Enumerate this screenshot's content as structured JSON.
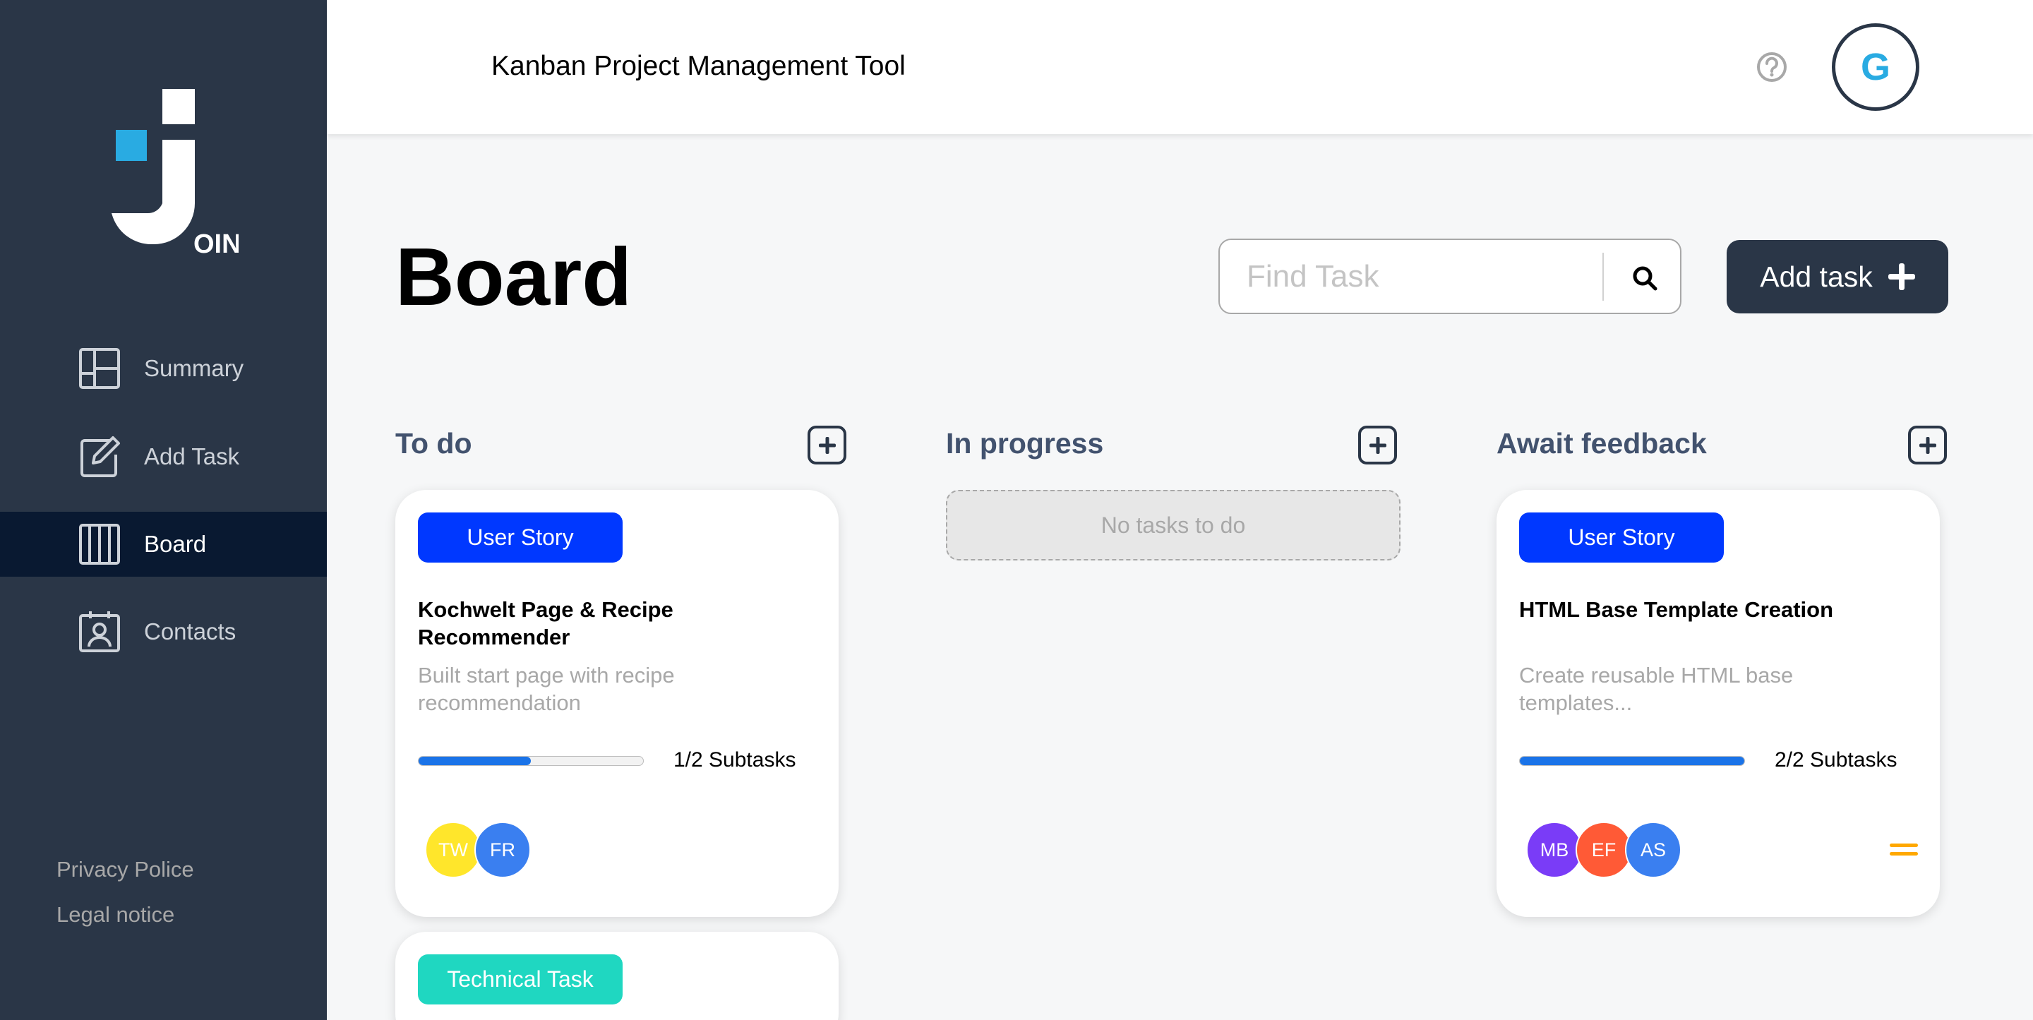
{
  "app": {
    "header_title": "Kanban Project Management Tool",
    "user_initial": "G",
    "logo_text": "OIN"
  },
  "sidebar": {
    "items": [
      {
        "label": "Summary",
        "icon": "summary-icon",
        "active": false
      },
      {
        "label": "Add Task",
        "icon": "add-task-icon",
        "active": false
      },
      {
        "label": "Board",
        "icon": "board-icon",
        "active": true
      },
      {
        "label": "Contacts",
        "icon": "contacts-icon",
        "active": false
      }
    ],
    "footer": {
      "privacy": "Privacy Police",
      "legal": "Legal notice"
    }
  },
  "board": {
    "title": "Board",
    "search_placeholder": "Find Task",
    "add_task_label": "Add task"
  },
  "columns": [
    {
      "title": "To do"
    },
    {
      "title": "In progress",
      "empty_text": "No tasks to do"
    },
    {
      "title": "Await feedback"
    }
  ],
  "cards": {
    "todo_1": {
      "category": "User Story",
      "category_color": "#0038ff",
      "title": "Kochwelt Page & Recipe Recommender",
      "description": "Built start page with recipe recommendation",
      "progress": 0.5,
      "subtasks": "1/2 Subtasks",
      "assignees": [
        {
          "initials": "TW",
          "color": "#ffe62b"
        },
        {
          "initials": "FR",
          "color": "#3a7ff0"
        }
      ]
    },
    "todo_2": {
      "category": "Technical Task",
      "category_color": "#1fd7c1"
    },
    "feedback_1": {
      "category": "User Story",
      "category_color": "#0038ff",
      "title": "HTML Base Template Creation",
      "description": "Create reusable HTML base templates...",
      "progress": 1.0,
      "subtasks": "2/2 Subtasks",
      "priority": "medium",
      "priority_color": "#ffa800",
      "assignees": [
        {
          "initials": "MB",
          "color": "#7a3cf7"
        },
        {
          "initials": "EF",
          "color": "#ff5a36"
        },
        {
          "initials": "AS",
          "color": "#3a7ff0"
        }
      ]
    }
  },
  "colors": {
    "sidebar_bg": "#2a3647",
    "sidebar_active": "#091931",
    "accent": "#29abe2"
  }
}
